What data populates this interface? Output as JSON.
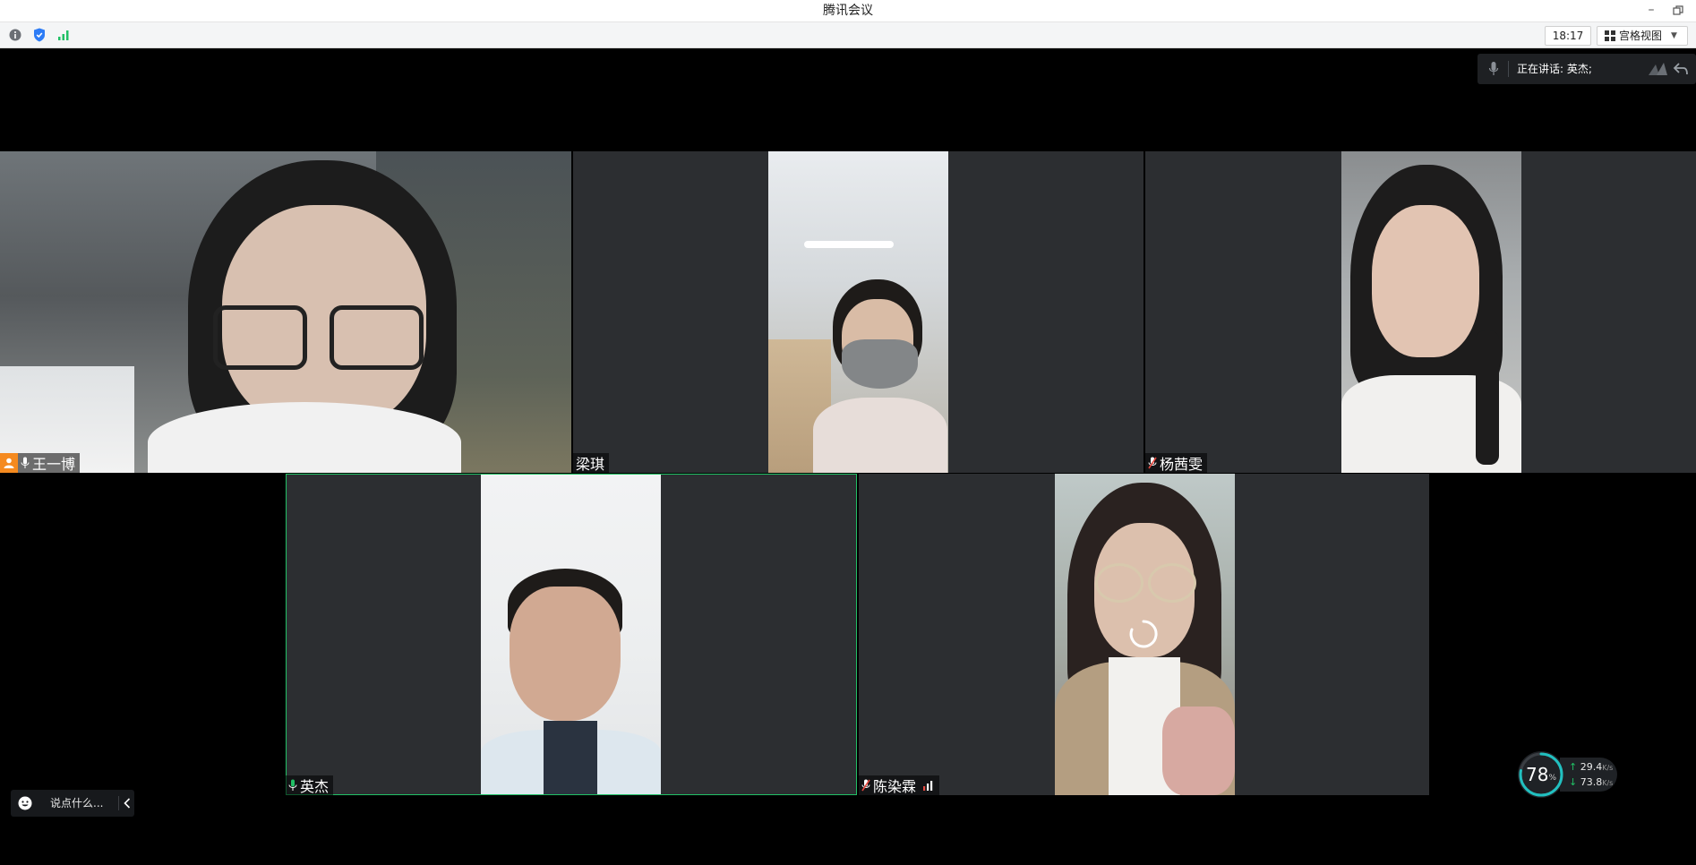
{
  "window": {
    "title": "腾讯会议"
  },
  "toolbar": {
    "time": "18:17",
    "view_label": "宫格视图",
    "icons": [
      "info-icon",
      "shield-icon",
      "signal-icon"
    ]
  },
  "speaking": {
    "text": "正在讲话: 英杰;"
  },
  "participants": [
    {
      "name": "王一博",
      "host": true,
      "mic": "on"
    },
    {
      "name": "梁琪",
      "mic": "none"
    },
    {
      "name": "杨茜雯",
      "mic": "muted"
    },
    {
      "name": "英杰",
      "mic": "on",
      "active": true
    },
    {
      "name": "陈染霖",
      "mic": "muted"
    }
  ],
  "chat": {
    "placeholder": "说点什么..."
  },
  "network": {
    "cpu_value": "78",
    "cpu_unit": "%",
    "cpu_percent": 78,
    "upload_value": "29.4",
    "download_value": "73.8",
    "rate_unit": "K/s"
  },
  "colors": {
    "accent_green": "#21c065",
    "host_orange": "#f58a1f",
    "tile_bg": "#2c2e31",
    "muted_red": "#e5483f"
  }
}
